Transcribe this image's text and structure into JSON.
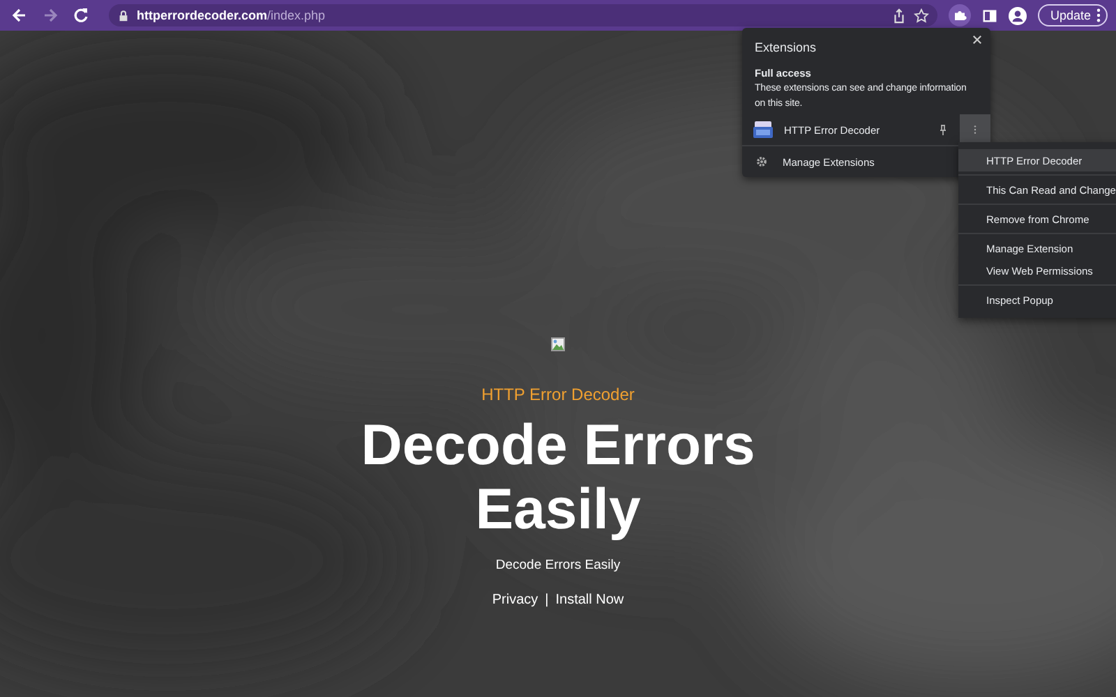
{
  "toolbar": {
    "nav_buttons": [
      {
        "kind": "back",
        "disabled": false
      },
      {
        "kind": "forward",
        "disabled": true
      },
      {
        "kind": "reload",
        "disabled": false
      }
    ],
    "url": {
      "host": "httperrordecoder.com",
      "path": "/index.php"
    },
    "extensions_active": true,
    "update_button": "Update"
  },
  "extensions_popup": {
    "title": "Extensions",
    "section_title": "Full access",
    "section_text": "These extensions can see and change information on this site.",
    "items": [
      {
        "name": "HTTP Error Decoder",
        "menu_open": true
      }
    ],
    "manage_label": "Manage Extensions"
  },
  "context_menu": {
    "groups": [
      [
        {
          "label": "HTTP Error Decoder",
          "selected": true
        }
      ],
      [
        {
          "label": "This Can Read and Change",
          "selected": false
        }
      ],
      [
        {
          "label": "Remove from Chrome",
          "selected": false
        }
      ],
      [
        {
          "label": "Manage Extension",
          "selected": false
        },
        {
          "label": "View Web Permissions",
          "selected": false
        }
      ],
      [
        {
          "label": "Inspect Popup",
          "selected": false
        }
      ]
    ]
  },
  "page": {
    "background": {
      "kind": "picture"
    },
    "eyebrow": "HTTP Error Decoder",
    "headline": "Decode Errors Easily",
    "subtitle": "Decode Errors Easily",
    "links": [
      "Privacy",
      "Install Now"
    ],
    "separator": "|"
  }
}
